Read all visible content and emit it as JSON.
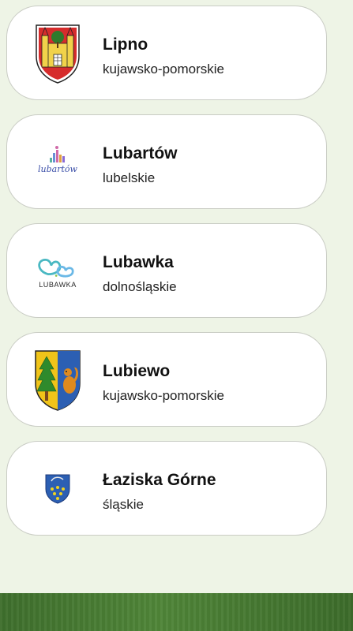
{
  "items": [
    {
      "name": "Lipno",
      "region": "kujawsko-pomorskie",
      "logo": "lipno-coat-of-arms-icon"
    },
    {
      "name": "Lubartów",
      "region": "lubelskie",
      "logo": "lubartow-logo-icon",
      "logo_text": "lubartów"
    },
    {
      "name": "Lubawka",
      "region": "dolnośląskie",
      "logo": "lubawka-logo-icon",
      "logo_text": "LUBAWKA"
    },
    {
      "name": "Lubiewo",
      "region": "kujawsko-pomorskie",
      "logo": "lubiewo-coat-of-arms-icon"
    },
    {
      "name": "Łaziska Górne",
      "region": "śląskie",
      "logo": "laziska-gorne-coat-of-arms-icon"
    }
  ],
  "colors": {
    "background": "#eef4e6",
    "card": "#ffffff",
    "card_border": "#c9ccc4",
    "footer": "#4a7d35"
  }
}
